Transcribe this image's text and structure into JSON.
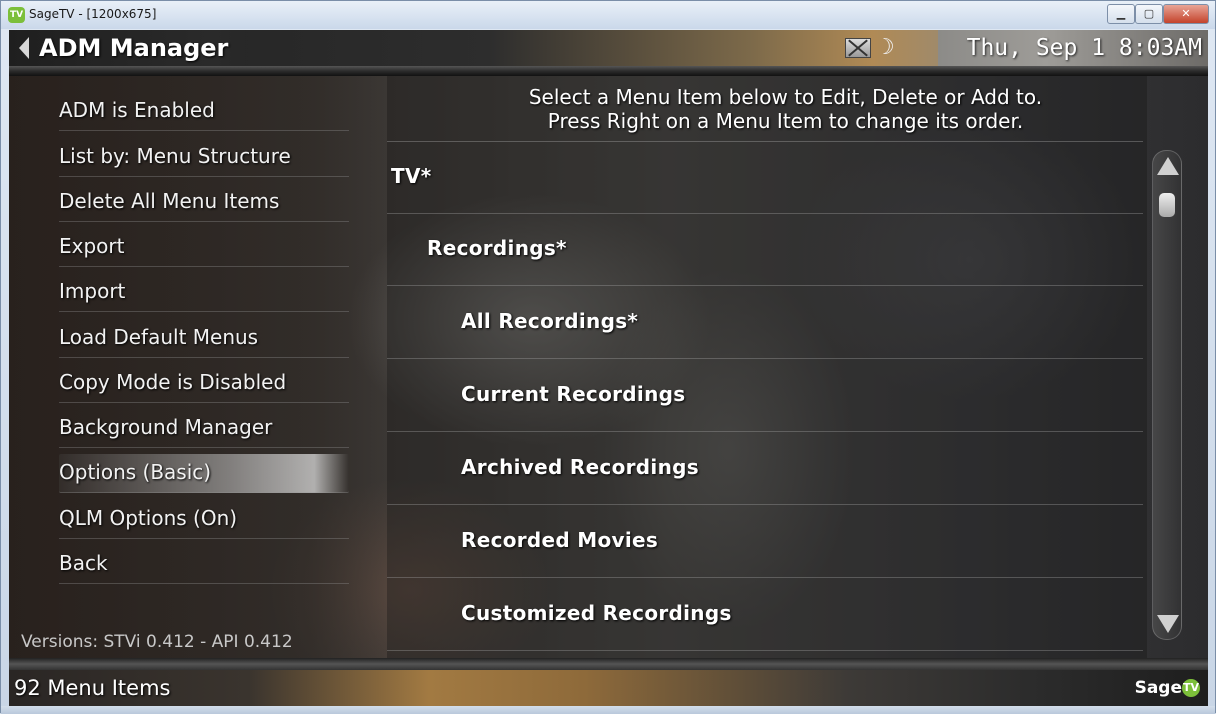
{
  "window": {
    "title": "SageTV - [1200x675]",
    "app_icon": "TV",
    "minimize": "▁",
    "maximize": "▢",
    "close": "✕"
  },
  "header": {
    "title": "ADM Manager",
    "clock": "Thu, Sep 1 8:03AM",
    "icons": [
      "back-arrow-icon",
      "screen-icon",
      "moon-icon"
    ]
  },
  "left_menu": {
    "items": [
      {
        "label": "ADM is Enabled"
      },
      {
        "label": "List by: Menu Structure"
      },
      {
        "label": "Delete All Menu Items"
      },
      {
        "label": "Export"
      },
      {
        "label": "Import"
      },
      {
        "label": "Load Default Menus"
      },
      {
        "label": "Copy Mode is Disabled"
      },
      {
        "label": "Background Manager"
      },
      {
        "label": "Options (Basic)",
        "selected": true
      },
      {
        "label": "QLM Options (On)"
      },
      {
        "label": "Back"
      }
    ],
    "versions": "Versions: STVi 0.412 - API 0.412"
  },
  "content": {
    "instructions_line1": "Select a Menu Item below to Edit, Delete or Add to.",
    "instructions_line2": "Press Right on a Menu Item to change its order.",
    "tree": [
      {
        "label": "TV*",
        "level": 0
      },
      {
        "label": "Recordings*",
        "level": 1
      },
      {
        "label": "All Recordings*",
        "level": 2
      },
      {
        "label": "Current Recordings",
        "level": 2
      },
      {
        "label": "Archived Recordings",
        "level": 2
      },
      {
        "label": "Recorded Movies",
        "level": 2
      },
      {
        "label": "Customized Recordings",
        "level": 2
      }
    ]
  },
  "footer": {
    "count": "92 Menu Items",
    "logo_text": "Sage",
    "logo_badge": "TV"
  }
}
